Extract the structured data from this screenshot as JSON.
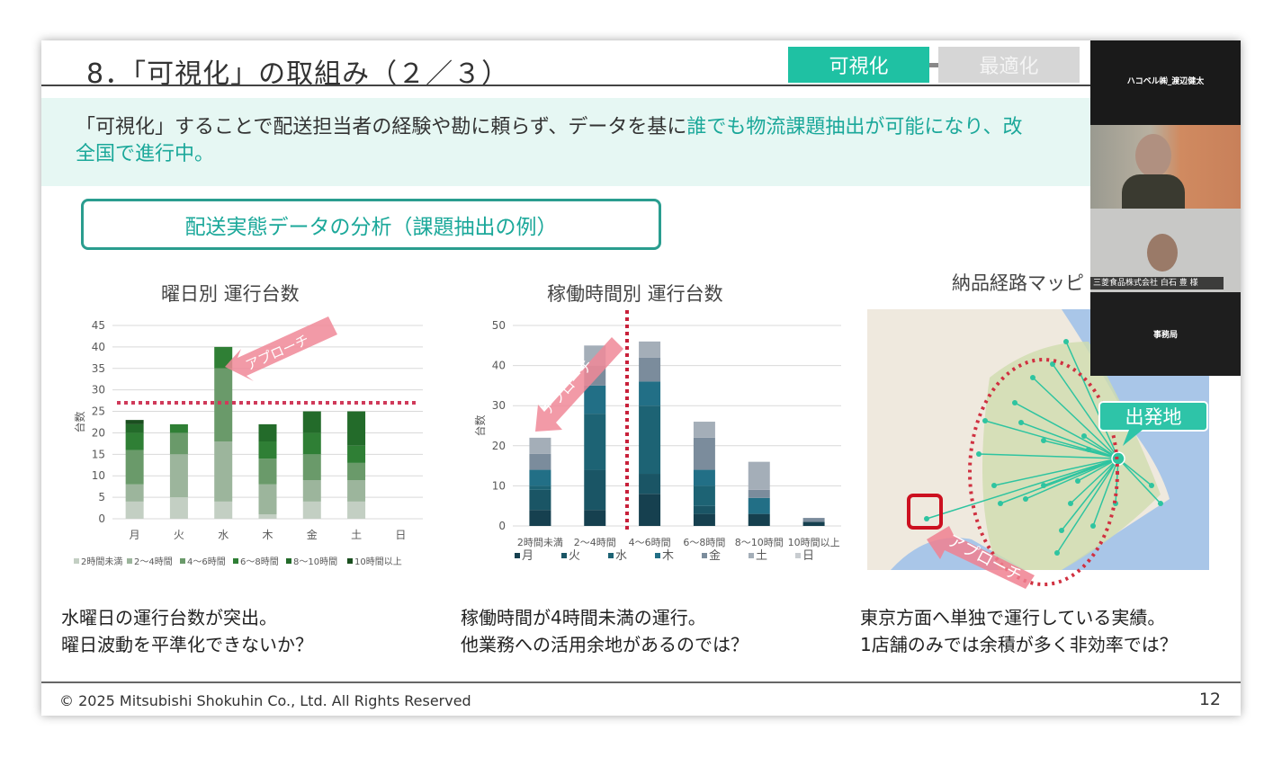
{
  "slide": {
    "title": "8．「可視化」の取組み（２／３）",
    "tabs": [
      {
        "label": "可視化",
        "color": "#1fc1a3"
      },
      {
        "label": "最適化",
        "color": "#d0d0d0"
      }
    ],
    "lead_plain": "「可視化」することで配送担当者の経験や勘に頼らず、データを基に",
    "lead_accent": "誰でも物流課題抽出が可能になり、改",
    "lead_line2": "全国で進行中。",
    "section_box": "配送実態データの分析（課題抽出の例）",
    "map_title": "納品経路マッピ",
    "map_labels": {
      "origin": "出発地",
      "approach": "アプローチ"
    },
    "captions": [
      [
        "水曜日の運行台数が突出。",
        "曜日波動を平準化できないか？"
      ],
      [
        "稼働時間が4時間未満の運行。",
        "他業務への活用余地があるのでは？"
      ],
      [
        "東京方面へ単独で運行している実績。",
        "1店舗のみでは余積が多く非効率では？"
      ]
    ],
    "footer": "© 2025 Mitsubishi Shokuhin Co., Ltd. All Rights Reserved",
    "page_number": "12"
  },
  "video": {
    "participants": [
      "ハコベル㈱_渡辺健太",
      "三菱食品株式会社 白石 豊 様",
      "事務局"
    ]
  },
  "chart_data": [
    {
      "type": "bar",
      "stacked": true,
      "title": "曜日別 運行台数",
      "ylabel": "台数",
      "ylim": [
        0,
        45
      ],
      "yticks": [
        0,
        5,
        10,
        15,
        20,
        25,
        30,
        35,
        40,
        45
      ],
      "categories": [
        "月",
        "火",
        "水",
        "木",
        "金",
        "土",
        "日"
      ],
      "series": [
        {
          "name": "2時間未満",
          "color": "#c3cfc3",
          "values": [
            4,
            5,
            4,
            1,
            4,
            4,
            0
          ]
        },
        {
          "name": "2～4時間",
          "color": "#9cb59c",
          "values": [
            4,
            10,
            14,
            7,
            5,
            5,
            0
          ]
        },
        {
          "name": "4～6時間",
          "color": "#6a9a6a",
          "values": [
            8,
            5,
            17,
            6,
            6,
            4,
            0
          ]
        },
        {
          "name": "6～8時間",
          "color": "#2f7f35",
          "values": [
            4,
            2,
            5,
            4,
            5,
            4,
            0
          ]
        },
        {
          "name": "8～10時間",
          "color": "#236b2a",
          "values": [
            2,
            0,
            0,
            4,
            5,
            8,
            0
          ]
        },
        {
          "name": "10時間以上",
          "color": "#1a4f1f",
          "values": [
            1,
            0,
            0,
            0,
            0,
            0,
            0
          ]
        }
      ],
      "reference_line": 27,
      "annotation": "アプローチ"
    },
    {
      "type": "bar",
      "stacked": true,
      "title": "稼働時間別 運行台数",
      "ylabel": "台数",
      "ylim": [
        0,
        50
      ],
      "yticks": [
        0,
        10,
        20,
        30,
        40,
        50
      ],
      "categories": [
        "2時間未満",
        "2～4時間",
        "4～6時間",
        "6～8時間",
        "8～10時間",
        "10時間以上"
      ],
      "series": [
        {
          "name": "月",
          "color": "#16404f",
          "values": [
            4,
            4,
            8,
            3,
            3,
            1
          ]
        },
        {
          "name": "火",
          "color": "#1a5565",
          "values": [
            5,
            10,
            5,
            2,
            0,
            0
          ]
        },
        {
          "name": "水",
          "color": "#1d6374",
          "values": [
            1,
            14,
            17,
            5,
            0,
            0
          ]
        },
        {
          "name": "木",
          "color": "#226f86",
          "values": [
            4,
            7,
            6,
            4,
            4,
            0
          ]
        },
        {
          "name": "金",
          "color": "#7b8c9c",
          "values": [
            4,
            5,
            6,
            8,
            2,
            1
          ]
        },
        {
          "name": "土",
          "color": "#a4aeb8",
          "values": [
            4,
            5,
            4,
            4,
            7,
            0
          ]
        },
        {
          "name": "日",
          "color": "#c8ccd0",
          "values": [
            0,
            0,
            0,
            0,
            0,
            0
          ]
        }
      ],
      "divider_between": [
        "2～4時間",
        "4～6時間"
      ],
      "annotation": "アプローチ"
    }
  ]
}
